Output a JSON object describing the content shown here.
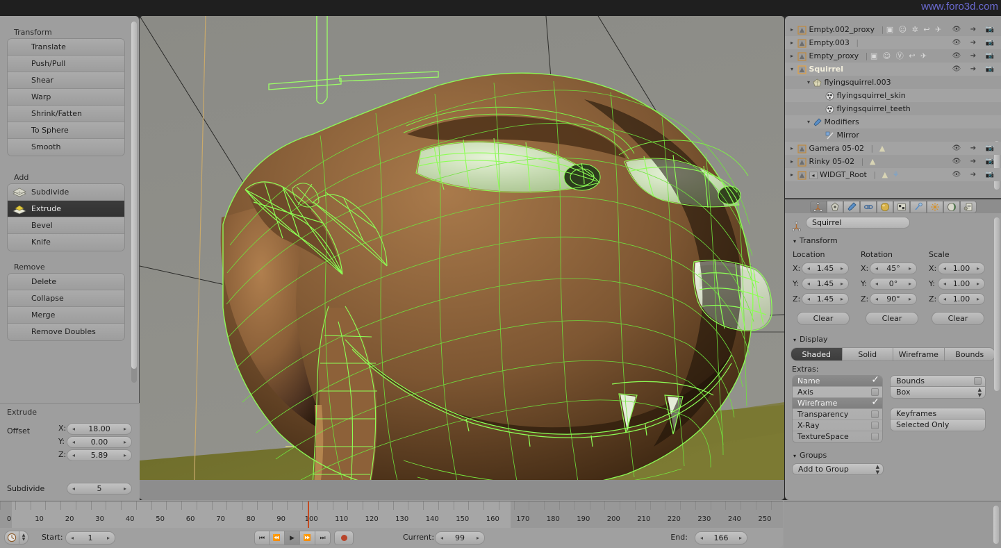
{
  "watermark": "www.foro3d.com",
  "toolshelf": {
    "groups": [
      {
        "title": "Transform",
        "items": [
          {
            "label": "Translate",
            "icon": "",
            "selected": false
          },
          {
            "label": "Push/Pull",
            "icon": "",
            "selected": false
          },
          {
            "label": "Shear",
            "icon": "",
            "selected": false
          },
          {
            "label": "Warp",
            "icon": "",
            "selected": false
          },
          {
            "label": "Shrink/Fatten",
            "icon": "",
            "selected": false
          },
          {
            "label": "To Sphere",
            "icon": "",
            "selected": false
          },
          {
            "label": "Smooth",
            "icon": "",
            "selected": false
          }
        ]
      },
      {
        "title": "Add",
        "items": [
          {
            "label": "Subdivide",
            "icon": "subdivide-icon",
            "selected": false
          },
          {
            "label": "Extrude",
            "icon": "extrude-icon",
            "selected": true
          },
          {
            "label": "Bevel",
            "icon": "",
            "selected": false
          },
          {
            "label": "Knife",
            "icon": "",
            "selected": false
          }
        ]
      },
      {
        "title": "Remove",
        "items": [
          {
            "label": "Delete",
            "icon": "",
            "selected": false
          },
          {
            "label": "Collapse",
            "icon": "",
            "selected": false
          },
          {
            "label": "Merge",
            "icon": "",
            "selected": false
          },
          {
            "label": "Remove Doubles",
            "icon": "",
            "selected": false
          }
        ]
      }
    ]
  },
  "operator_panel": {
    "title": "Extrude",
    "offset_label": "Offset",
    "offset": [
      {
        "axis": "X:",
        "value": "18.00"
      },
      {
        "axis": "Y:",
        "value": "0.00"
      },
      {
        "axis": "Z:",
        "value": "5.89"
      }
    ],
    "subdivide_label": "Subdivide",
    "subdivide_value": "5"
  },
  "outliner": {
    "rows": [
      {
        "indent": 0,
        "tri": "right",
        "icon": "empty-object-icon",
        "label": "Empty.002_proxy",
        "highlight": false,
        "extra_icons": [
          "cube-data-icon",
          "armature-icon",
          "pose-icon",
          "action-icon",
          "walk-icon"
        ],
        "cols": [
          "eye-icon",
          "cursor-icon",
          "camera-icon"
        ]
      },
      {
        "indent": 0,
        "tri": "right",
        "icon": "empty-object-icon",
        "label": "Empty.003",
        "highlight": false,
        "extra_icons": [],
        "cols": [
          "eye-icon",
          "cursor-icon",
          "camera-icon"
        ]
      },
      {
        "indent": 0,
        "tri": "right",
        "icon": "empty-object-icon",
        "label": "Empty_proxy",
        "highlight": false,
        "extra_icons": [
          "cube-data-icon",
          "armature-icon",
          "group-icon",
          "action-icon",
          "walk-icon"
        ],
        "cols": [
          "eye-icon",
          "cursor-icon",
          "camera-icon"
        ]
      },
      {
        "indent": 0,
        "tri": "down",
        "icon": "empty-object-icon",
        "label": "Squirrel",
        "highlight": true,
        "extra_icons": [],
        "cols": [
          "eye-icon",
          "cursor-icon",
          "camera-icon"
        ]
      },
      {
        "indent": 1,
        "tri": "down",
        "icon": "mesh-data-icon",
        "label": "flyingsquirrel.003",
        "highlight": false,
        "extra_icons": [],
        "cols": []
      },
      {
        "indent": 2,
        "tri": "",
        "icon": "material-icon",
        "label": "flyingsquirrel_skin",
        "highlight": false,
        "extra_icons": [],
        "cols": []
      },
      {
        "indent": 2,
        "tri": "",
        "icon": "material-icon",
        "label": "flyingsquirrel_teeth",
        "highlight": false,
        "extra_icons": [],
        "cols": []
      },
      {
        "indent": 1,
        "tri": "down",
        "icon": "wrench-icon",
        "label": "Modifiers",
        "highlight": false,
        "extra_icons": [],
        "cols": []
      },
      {
        "indent": 2,
        "tri": "",
        "icon": "mirror-modifier-icon",
        "label": "Mirror",
        "highlight": false,
        "extra_icons": [],
        "cols": []
      },
      {
        "indent": 0,
        "tri": "right",
        "icon": "empty-object-icon",
        "label": "Gamera 05-02",
        "highlight": false,
        "extra_icons": [
          "mesh-data-icon"
        ],
        "cols": [
          "eye-icon",
          "cursor-icon",
          "camera-icon"
        ]
      },
      {
        "indent": 0,
        "tri": "right",
        "icon": "empty-object-icon",
        "label": "Rinky 05-02",
        "highlight": false,
        "extra_icons": [
          "mesh-data-icon"
        ],
        "cols": [
          "eye-icon",
          "cursor-icon",
          "camera-icon"
        ]
      },
      {
        "indent": 0,
        "tri": "right",
        "icon": "empty-object-icon",
        "label": "WIDGT_Root",
        "highlight": false,
        "extra_icons": [
          "mesh-data-icon",
          "wrench-icon"
        ],
        "cols": [
          "eye-icon",
          "cursor-icon",
          "camera-icon"
        ]
      }
    ]
  },
  "properties": {
    "tabs": [
      {
        "name": "object-tab",
        "icon": "object-axes-icon",
        "active": true
      },
      {
        "name": "render-tab",
        "icon": "camera-back-icon",
        "active": false
      },
      {
        "name": "modifier-tab",
        "icon": "wrench-icon",
        "active": false
      },
      {
        "name": "physics-tab",
        "icon": "chain-icon",
        "active": false
      },
      {
        "name": "material-tab",
        "icon": "sphere-icon",
        "active": false
      },
      {
        "name": "texture-tab",
        "icon": "checker-icon",
        "active": false
      },
      {
        "name": "constraint-tab",
        "icon": "clamp-icon",
        "active": false
      },
      {
        "name": "particles-tab",
        "icon": "particles-icon",
        "active": false
      },
      {
        "name": "world-tab",
        "icon": "world-icon",
        "active": false
      },
      {
        "name": "scene-tab",
        "icon": "scene-icon",
        "active": false
      }
    ],
    "object_name": "Squirrel",
    "transform": {
      "title": "Transform",
      "columns": [
        "Location",
        "Rotation",
        "Scale"
      ],
      "location": [
        {
          "axis": "X:",
          "value": "1.45"
        },
        {
          "axis": "Y:",
          "value": "1.45"
        },
        {
          "axis": "Z:",
          "value": "1.45"
        }
      ],
      "rotation": [
        {
          "axis": "X:",
          "value": "45°"
        },
        {
          "axis": "Y:",
          "value": "0°"
        },
        {
          "axis": "Z:",
          "value": "90°"
        }
      ],
      "scale": [
        {
          "axis": "X:",
          "value": "1.00"
        },
        {
          "axis": "Y:",
          "value": "1.00"
        },
        {
          "axis": "Z:",
          "value": "1.00"
        }
      ],
      "clear_labels": [
        "Clear",
        "Clear",
        "Clear"
      ]
    },
    "display": {
      "title": "Display",
      "modes": [
        {
          "label": "Shaded",
          "active": true
        },
        {
          "label": "Solid",
          "active": false
        },
        {
          "label": "Wireframe",
          "active": false
        },
        {
          "label": "Bounds",
          "active": false
        }
      ],
      "extras_label": "Extras:",
      "extras": [
        {
          "label": "Name",
          "checked": true
        },
        {
          "label": "Axis",
          "checked": false
        },
        {
          "label": "Wireframe",
          "checked": true
        },
        {
          "label": "Transparency",
          "checked": false
        },
        {
          "label": "X-Ray",
          "checked": false
        },
        {
          "label": "TextureSpace",
          "checked": false
        }
      ],
      "bounds_label": "Bounds",
      "bounds_checked": false,
      "bounds_type": "Box",
      "keyframes_label": "Keyframes",
      "selected_only_label": "Selected Only"
    },
    "groups": {
      "title": "Groups",
      "add_to_group": "Add to Group"
    }
  },
  "timeline": {
    "start_label": "Start:",
    "start_value": "1",
    "current_label": "Current:",
    "current_value": "99",
    "end_label": "End:",
    "end_value": "166",
    "playhead_frame": 99,
    "frame_min": -3,
    "frame_max": 256,
    "tick_labels": [
      0,
      10,
      20,
      30,
      40,
      50,
      60,
      70,
      80,
      90,
      100,
      110,
      120,
      130,
      140,
      150,
      160,
      170,
      180,
      190,
      200,
      210,
      220,
      230,
      240,
      250
    ],
    "transport": [
      {
        "name": "jump-to-start-button",
        "glyph": "⏮"
      },
      {
        "name": "play-reverse-button",
        "glyph": "⏪"
      },
      {
        "name": "play-button",
        "glyph": "▶"
      },
      {
        "name": "play-forward-button",
        "glyph": "⏩"
      },
      {
        "name": "jump-to-end-button",
        "glyph": "⏭"
      }
    ],
    "record_button": "record-icon",
    "editor_type_icon": "clock-icon"
  },
  "colors": {
    "panel_bg": "#9e9e9e",
    "viewport_bg": "#8e8e8e",
    "wire_green": "#63e034",
    "selected_tool_bg": "#343434",
    "playhead": "#c44a20",
    "watermark": "#6a6ad0"
  }
}
